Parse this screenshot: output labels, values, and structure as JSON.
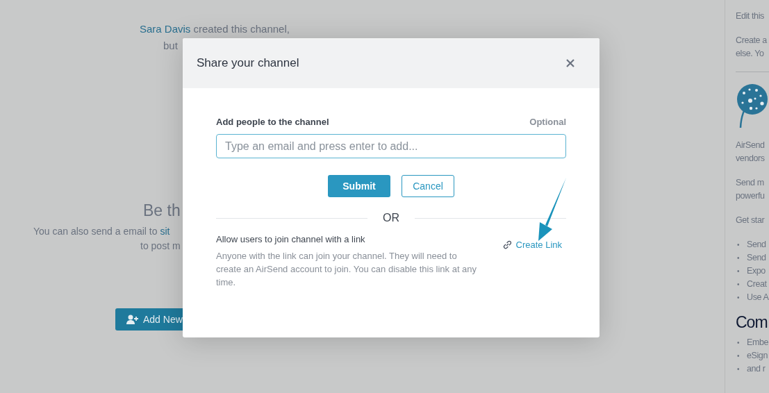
{
  "channel_view": {
    "creator_link": "Sara Davis",
    "creator_text": " created this channel,",
    "note_line_2": "but",
    "heading": "Be th",
    "email_text": "You can also send a email to ",
    "email_link": "sit",
    "email_line_2": "to post m",
    "add_button": "Add New"
  },
  "dialog": {
    "title": "Share your channel",
    "field_label": "Add people to the channel",
    "optional": "Optional",
    "placeholder": "Type an email and press enter to add...",
    "submit": "Submit",
    "cancel": "Cancel",
    "divider": "OR",
    "link_title": "Allow users to join channel with a link",
    "link_description": "Anyone with the link can join your channel. They will need to create an AirSend account to join. You can disable this link at any time.",
    "create_link": "Create Link"
  },
  "side_panel": {
    "paragraphs_top": [
      [
        "Edit this"
      ],
      [
        "Create a",
        "else. Yo"
      ]
    ],
    "paragraphs": [
      [
        "AirSend",
        "vendors"
      ],
      [
        "Send m",
        "powerfu"
      ],
      [
        "Get star"
      ]
    ],
    "bullets": [
      {
        "marker": "•",
        "text": "Send"
      },
      {
        "marker": "•",
        "text": "Send"
      },
      {
        "marker": "•",
        "text": "Expo"
      },
      {
        "marker": "•",
        "text": "Creat"
      },
      {
        "marker": "•",
        "text": "Use A"
      }
    ],
    "heading": "Com",
    "bullets_2": [
      {
        "marker": "•",
        "text": "Embe"
      },
      {
        "marker": "•",
        "text": "eSign"
      },
      {
        "marker": "•",
        "text": "and r"
      }
    ]
  }
}
